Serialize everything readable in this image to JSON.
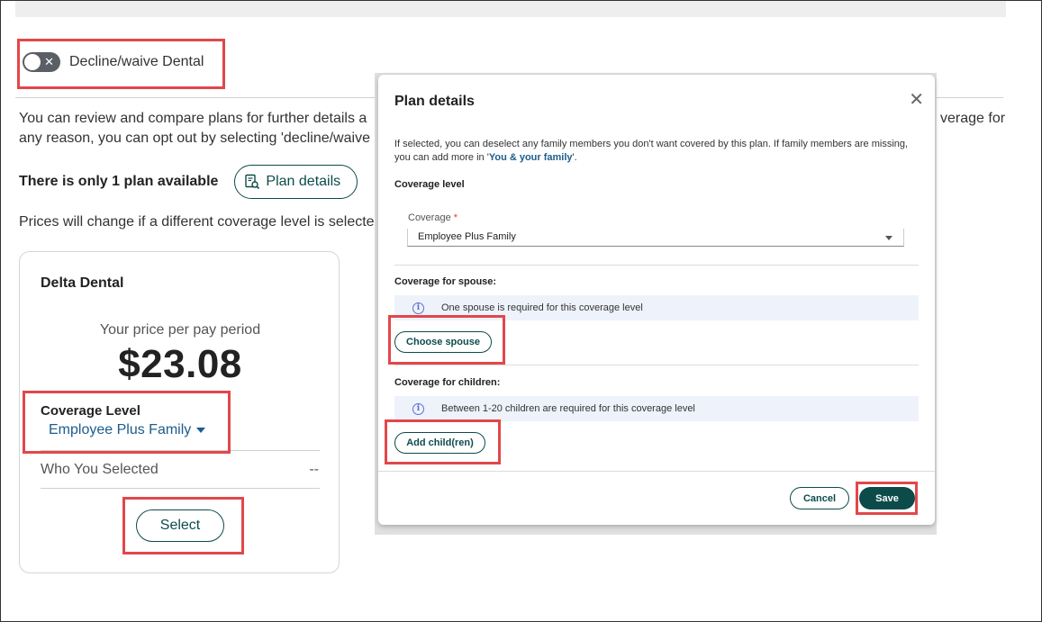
{
  "toggle": {
    "label": "Decline/waive Dental"
  },
  "intro": {
    "line1": "You can review and compare plans for further details a",
    "line1_right": "verage for",
    "line2": "any reason, you can opt out by selecting 'decline/waive"
  },
  "plans": {
    "count_text": "There is only 1 plan available",
    "details_label": "Plan details"
  },
  "prices_note": "Prices will change if a different coverage level is selecte",
  "card": {
    "title": "Delta Dental",
    "price_label": "Your price per pay period",
    "price": "$23.08",
    "coverage_label": "Coverage Level",
    "coverage_value": "Employee Plus Family",
    "who_label": "Who You Selected",
    "who_value": "--",
    "select_label": "Select"
  },
  "modal": {
    "title": "Plan details",
    "close_glyph": "✕",
    "desc_part1": "If selected, you can deselect any family members you don't want covered by this plan. If family members are missing, you can add more in '",
    "desc_link": "You & your family",
    "desc_part2": "'.",
    "coverage_section": "Coverage level",
    "coverage_field_label": "Coverage",
    "coverage_required": "*",
    "coverage_value": "Employee Plus Family",
    "spouse_section": "Coverage for spouse:",
    "spouse_info": "One spouse is required for this coverage level",
    "spouse_button": "Choose spouse",
    "children_section": "Coverage for children:",
    "children_info": "Between 1-20 children are required for this coverage level",
    "children_button": "Add child(ren)",
    "cancel_label": "Cancel",
    "save_label": "Save",
    "info_glyph": "i"
  },
  "colors": {
    "highlight": "#e2474a",
    "brand": "#0d4b4b",
    "link": "#1d5c8c",
    "info_bg": "#eef2fb"
  },
  "icons": [
    "toggle-x-icon",
    "plan-details-icon",
    "caret-down-icon",
    "close-icon",
    "info-icon",
    "select-arrow-icon"
  ]
}
